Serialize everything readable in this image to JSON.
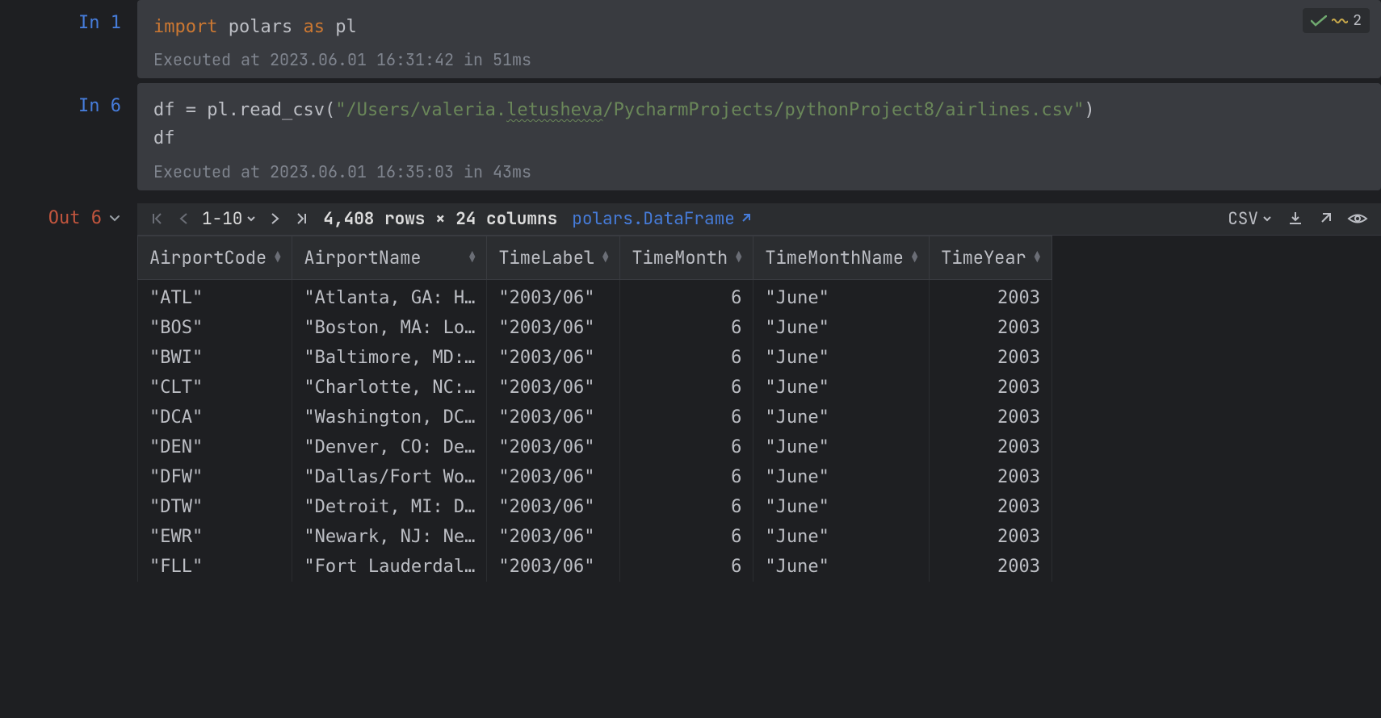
{
  "problems_badge": {
    "count": "2"
  },
  "cells": {
    "cell1": {
      "label": "In 1",
      "code": {
        "import_kw": "import",
        "module": "polars",
        "as_kw": "as",
        "alias": "pl"
      },
      "exec": "Executed at 2023.06.01 16:31:42 in 51ms"
    },
    "cell2": {
      "label": "In 6",
      "code": {
        "lhs": "df",
        "eq": " = ",
        "call_prefix": "pl.read_csv(",
        "str_open": "\"",
        "path_pre": "/Users/valeria.",
        "path_under": "letusheva",
        "path_post": "/PycharmProjects/pythonProject8/airlines.csv",
        "str_close": "\"",
        "call_close": ")",
        "line2": "df"
      },
      "exec": "Executed at 2023.06.01 16:35:03 in 43ms"
    },
    "out": {
      "label": "Out 6",
      "toolbar": {
        "page_range": "1-10",
        "dims": "4,408 rows × 24 columns",
        "type_label": "polars.DataFrame",
        "export_format": "CSV"
      },
      "columns": [
        "AirportCode",
        "AirportName",
        "TimeLabel",
        "TimeMonth",
        "TimeMonthName",
        "TimeYear"
      ],
      "numeric_cols": [
        3,
        5
      ],
      "rows": [
        [
          "\"ATL\"",
          "\"Atlanta, GA: H…",
          "\"2003/06\"",
          "6",
          "\"June\"",
          "2003"
        ],
        [
          "\"BOS\"",
          "\"Boston, MA: Lo…",
          "\"2003/06\"",
          "6",
          "\"June\"",
          "2003"
        ],
        [
          "\"BWI\"",
          "\"Baltimore, MD:…",
          "\"2003/06\"",
          "6",
          "\"June\"",
          "2003"
        ],
        [
          "\"CLT\"",
          "\"Charlotte, NC:…",
          "\"2003/06\"",
          "6",
          "\"June\"",
          "2003"
        ],
        [
          "\"DCA\"",
          "\"Washington, DC…",
          "\"2003/06\"",
          "6",
          "\"June\"",
          "2003"
        ],
        [
          "\"DEN\"",
          "\"Denver, CO: De…",
          "\"2003/06\"",
          "6",
          "\"June\"",
          "2003"
        ],
        [
          "\"DFW\"",
          "\"Dallas/Fort Wo…",
          "\"2003/06\"",
          "6",
          "\"June\"",
          "2003"
        ],
        [
          "\"DTW\"",
          "\"Detroit, MI: D…",
          "\"2003/06\"",
          "6",
          "\"June\"",
          "2003"
        ],
        [
          "\"EWR\"",
          "\"Newark, NJ: Ne…",
          "\"2003/06\"",
          "6",
          "\"June\"",
          "2003"
        ],
        [
          "\"FLL\"",
          "\"Fort Lauderdal…",
          "\"2003/06\"",
          "6",
          "\"June\"",
          "2003"
        ]
      ]
    }
  }
}
